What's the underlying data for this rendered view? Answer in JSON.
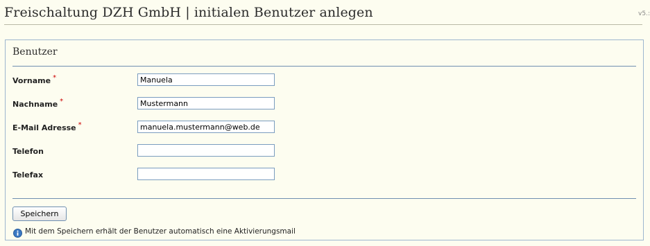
{
  "header": {
    "title": "Freischaltung DZH GmbH | initialen Benutzer anlegen",
    "version": "v5.:"
  },
  "panel": {
    "title": "Benutzer",
    "fields": [
      {
        "label": "Vorname",
        "required": true,
        "value": "Manuela",
        "required_mark": "*"
      },
      {
        "label": "Nachname",
        "required": true,
        "value": "Mustermann",
        "required_mark": "*"
      },
      {
        "label": "E-Mail Adresse",
        "required": true,
        "value": "manuela.mustermann@web.de",
        "required_mark": "*"
      },
      {
        "label": "Telefon",
        "required": false,
        "value": ""
      },
      {
        "label": "Telefax",
        "required": false,
        "value": ""
      }
    ],
    "save_label": "Speichern",
    "hint_text": "Mit dem Speichern erhält der Benutzer automatisch eine Aktivierungsmail",
    "hint_icon": "info-icon"
  },
  "colors": {
    "background": "#fdfdf0",
    "panel_border": "#9db6cf",
    "rule": "#6f8fb0",
    "required": "#cc0000",
    "info_icon": "#3a78c2"
  }
}
